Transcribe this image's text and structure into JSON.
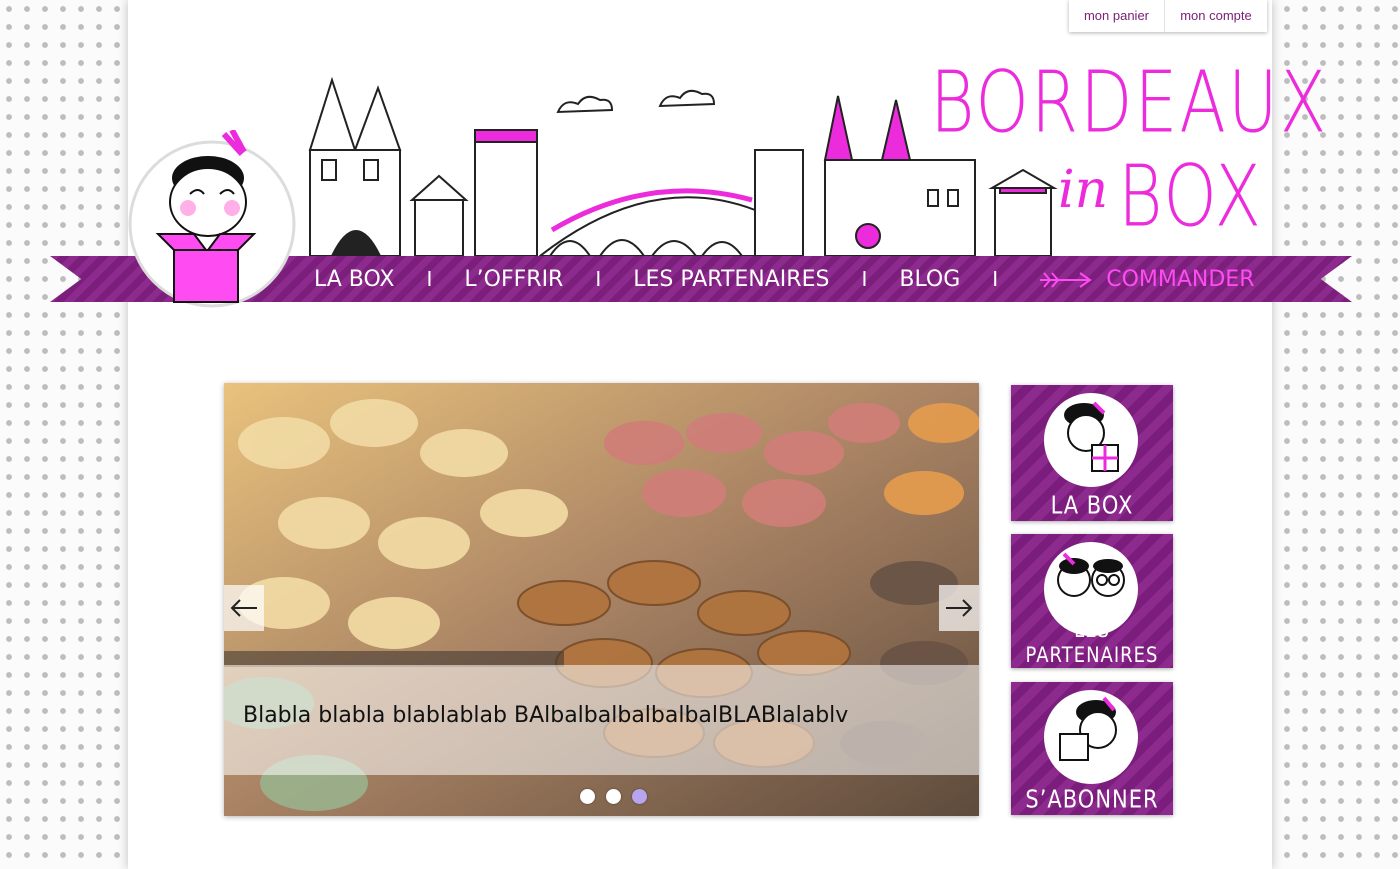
{
  "header": {
    "top_links": {
      "cart": "mon panier",
      "account": "mon compte"
    },
    "logo": {
      "line1": "BORDEAUX",
      "connector": "in",
      "line2": "BOX"
    }
  },
  "nav": {
    "items": [
      {
        "label": "LA BOX"
      },
      {
        "label": "L’OFFRIR"
      },
      {
        "label": "LES PARTENAIRES"
      },
      {
        "label": "BLOG"
      }
    ],
    "separator": "I",
    "cta": "COMMANDER"
  },
  "slider": {
    "caption": "Blabla blabla blablablab BAlbalbalbalbalbalBLABlalablv",
    "dots": {
      "count": 3,
      "active": 3
    },
    "prev_icon": "arrow-left-icon",
    "next_icon": "arrow-right-icon"
  },
  "side_boxes": [
    {
      "label": "LA BOX",
      "icon": "girl-with-gift-icon"
    },
    {
      "label": "LES PARTENAIRES",
      "icon": "partners-couple-icon"
    },
    {
      "label": "S’ABONNER",
      "icon": "girl-with-box-icon"
    }
  ],
  "colors": {
    "brand_pink": "#ec2bdc",
    "brand_purple": "#7b1e7c",
    "cta_pink": "#ff4cf2",
    "active_dot": "#b7a6ef"
  }
}
